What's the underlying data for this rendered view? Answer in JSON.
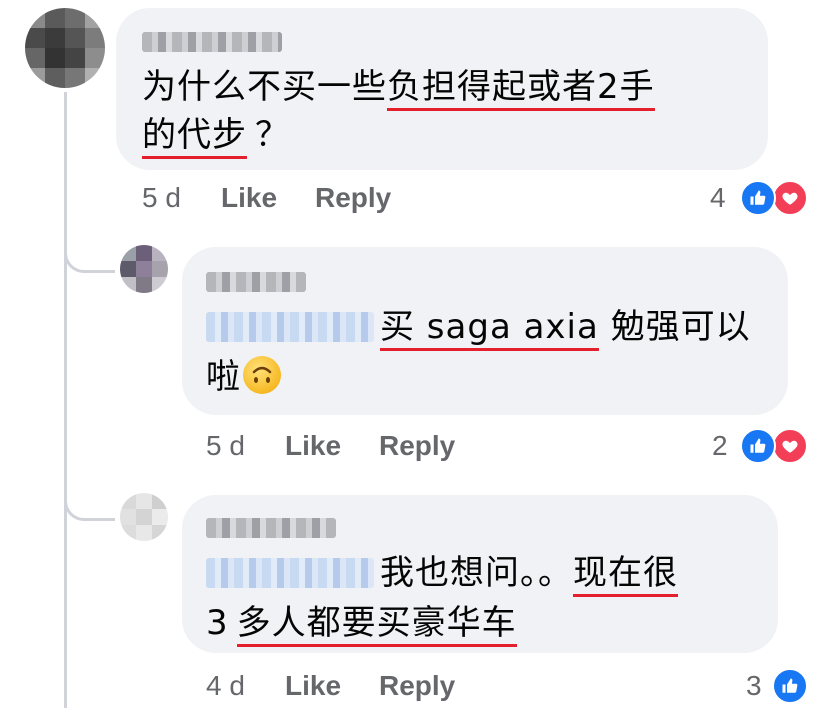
{
  "comments": [
    {
      "text_plain": "为什么不买一些",
      "text_ul_1": "负担得起或者2手",
      "text_ul_2": "的代步",
      "text_tail": "？",
      "time": "5 d",
      "like_label": "Like",
      "reply_label": "Reply",
      "reaction_count": "4",
      "reactions": [
        "like-icon",
        "love-icon"
      ]
    },
    {
      "text_ul": "买 saga axia",
      "text_plain": " 勉强可以",
      "text_line2": "啦",
      "emoji": "upside-down-face-icon",
      "time": "5 d",
      "like_label": "Like",
      "reply_label": "Reply",
      "reaction_count": "2",
      "reactions": [
        "like-icon",
        "love-icon"
      ]
    },
    {
      "text_plain": "我也想问。。",
      "text_ul_1": "现在很",
      "text_line2_plain": "3",
      "text_ul_2": "多人都要买豪华车",
      "time": "4 d",
      "like_label": "Like",
      "reply_label": "Reply",
      "reaction_count": "3",
      "reactions": [
        "like-icon"
      ]
    }
  ],
  "colors": {
    "bubble": "#f0f2f5",
    "underline": "#e4202d",
    "meta": "#65676b",
    "like": "#1877f2",
    "love": "#f33e58"
  }
}
